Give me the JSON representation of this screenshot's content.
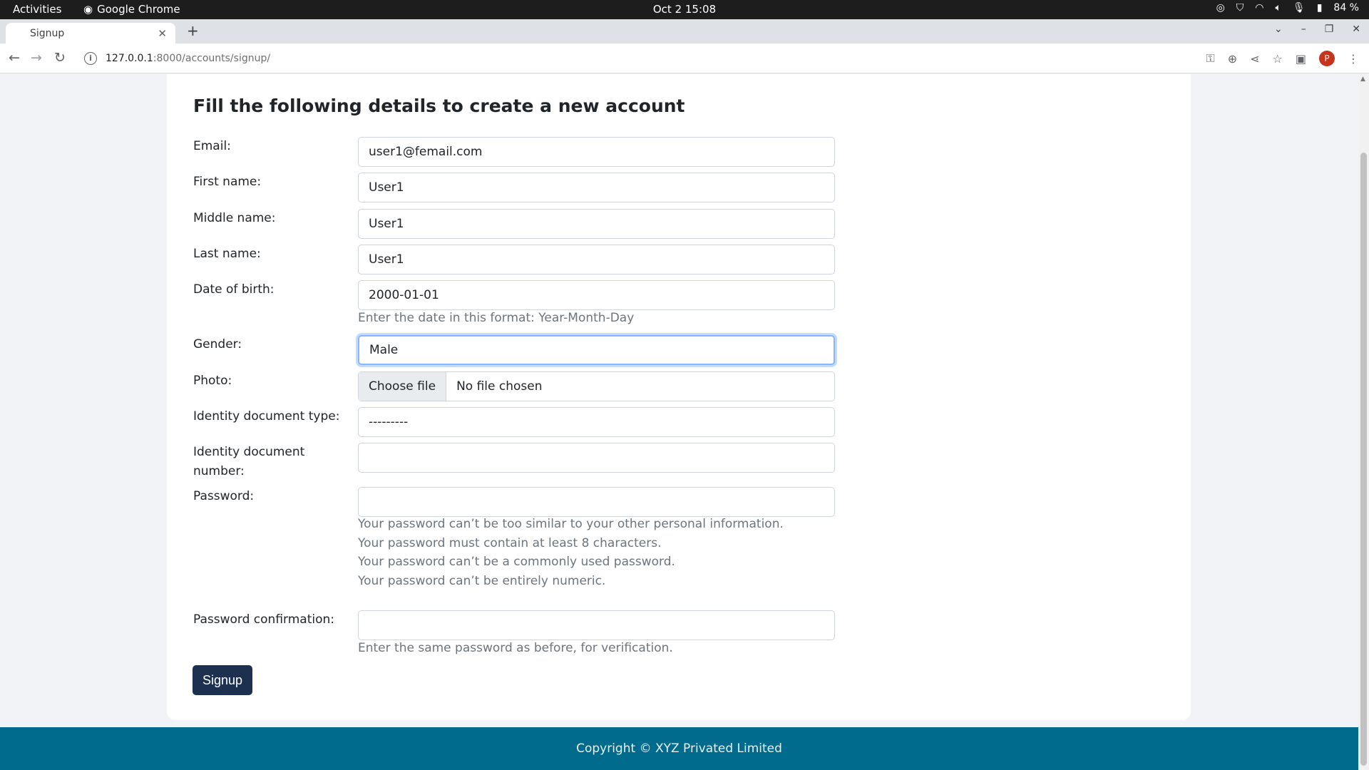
{
  "system": {
    "activities": "Activities",
    "app_name": "Google Chrome",
    "clock": "Oct 2  15:08",
    "battery": "84 %"
  },
  "browser": {
    "tab_title": "Signup",
    "url_host": "127.0.0.1",
    "url_path": ":8000/accounts/signup/"
  },
  "form": {
    "heading": "Fill the following details to create a new account",
    "email_label": "Email:",
    "email_value": "user1@femail.com",
    "first_name_label": "First name:",
    "first_name_value": "User1",
    "middle_name_label": "Middle name:",
    "middle_name_value": "User1",
    "last_name_label": "Last name:",
    "last_name_value": "User1",
    "dob_label": "Date of birth:",
    "dob_value": "2000-01-01",
    "dob_help": "Enter the date in this format: Year-Month-Day",
    "gender_label": "Gender:",
    "gender_value": "Male",
    "photo_label": "Photo:",
    "photo_button": "Choose file",
    "photo_status": "No file chosen",
    "id_type_label": "Identity document type:",
    "id_type_value": "---------",
    "id_number_label": "Identity document number:",
    "id_number_value": "",
    "password_label": "Password:",
    "password_value": "",
    "password_help": [
      "Your password can’t be too similar to your other personal information.",
      "Your password must contain at least 8 characters.",
      "Your password can’t be a commonly used password.",
      "Your password can’t be entirely numeric."
    ],
    "password_confirm_label": "Password confirmation:",
    "password_confirm_value": "",
    "password_confirm_help": "Enter the same password as before, for verification.",
    "submit_label": "Signup"
  },
  "footer": {
    "copyright": "Copyright © XYZ Privated Limited"
  },
  "colors": {
    "submit_bg": "#1e3050",
    "footer_bg": "#006b8c",
    "focus_ring": "#86b7fe",
    "avatar_bg": "#c5341c"
  }
}
